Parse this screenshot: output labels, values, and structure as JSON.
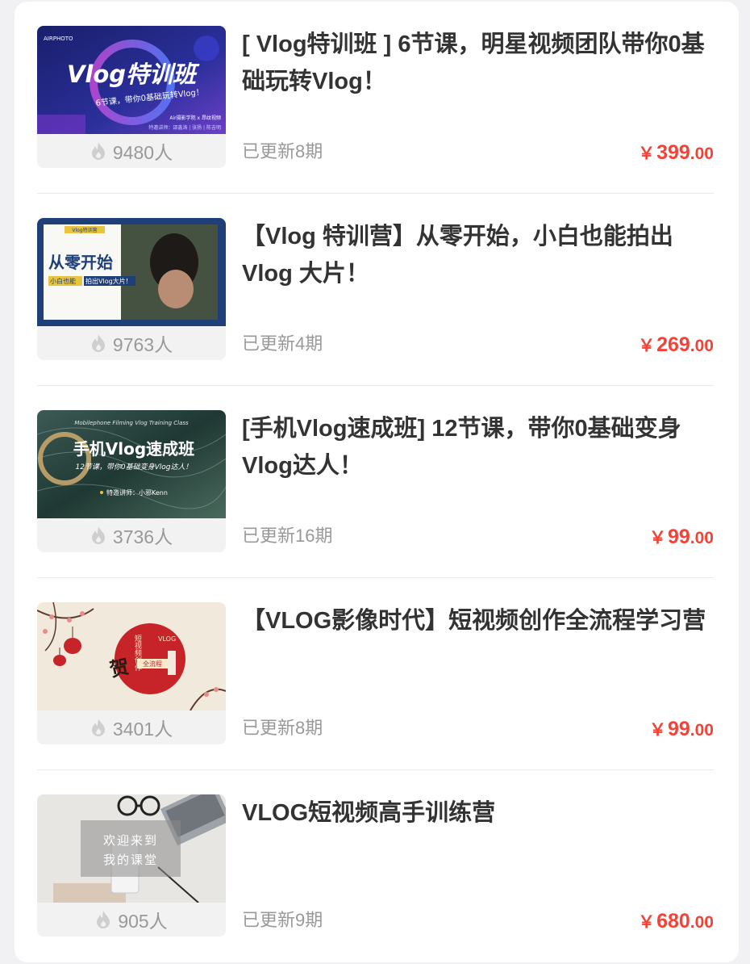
{
  "courses": [
    {
      "title": "[ Vlog特训班 ] 6节课，明星视频团队带你0基础玩转Vlog！",
      "students": "9480人",
      "updated": "已更新8期",
      "price_int": "399",
      "price_dec": ".00",
      "currency": "￥",
      "thumb": {
        "headline": "Vlog特训班",
        "sub": "6节课，带你0基础玩转Vlog！",
        "brand": "Air摄影学院 x 昂纹视频",
        "credits": "特邀讲师：邵鑫涛 | 张扬 | 陈吉明",
        "logo_text": "AIRPHOTO"
      }
    },
    {
      "title": "【Vlog 特训营】从零开始，小白也能拍出 Vlog 大片！",
      "students": "9763人",
      "updated": "已更新4期",
      "price_int": "269",
      "price_dec": ".00",
      "currency": "￥",
      "thumb": {
        "tag": "Vlog特训营",
        "headline": "从零开始",
        "sub_a": "小白也能",
        "sub_b": "拍出Vlog大片！"
      }
    },
    {
      "title": "[手机Vlog速成班] 12节课，带你0基础变身Vlog达人！",
      "students": "3736人",
      "updated": "已更新16期",
      "price_int": "99",
      "price_dec": ".00",
      "currency": "￥",
      "thumb": {
        "top": "Mobilephone Filming Vlog Training Class",
        "headline": "手机Vlog速成班",
        "sub": "12节课，带你0基础变身Vlog达人！",
        "teacher": "特邀讲师：小邪Kenn"
      }
    },
    {
      "title": "【VLOG影像时代】短视频创作全流程学习营",
      "students": "3401人",
      "updated": "已更新8期",
      "price_int": "99",
      "price_dec": ".00",
      "currency": "￥",
      "thumb": {
        "seal": "贺",
        "vertical": "短视频创作",
        "badge": "全流程",
        "label": "VLOG"
      }
    },
    {
      "title": "VLOG短视频高手训练营",
      "students": "905人",
      "updated": "已更新9期",
      "price_int": "680",
      "price_dec": ".00",
      "currency": "￥",
      "thumb": {
        "line1": "欢迎来到",
        "line2": "我的课堂"
      }
    }
  ],
  "colors": {
    "price": "#f44336",
    "muted": "#999999",
    "title": "#333333"
  },
  "icons": {
    "stats": "flame-icon"
  }
}
